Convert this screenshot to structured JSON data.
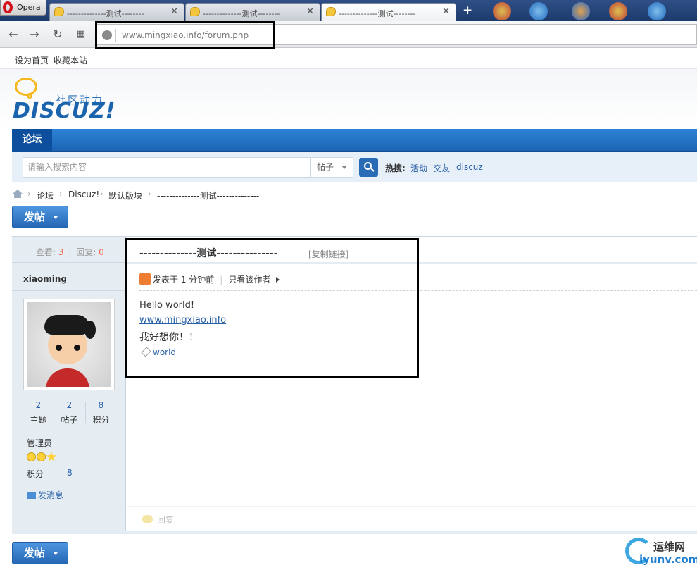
{
  "browser": {
    "app_label": "Opera",
    "tabs": [
      {
        "label": "--------------测试--------"
      },
      {
        "label": "--------------测试--------"
      },
      {
        "label": "--------------测试--------"
      }
    ],
    "url": "www.mingxiao.info/forum.php"
  },
  "linkbar": {
    "set_home": "设为首页",
    "bookmark": "收藏本站"
  },
  "logo": {
    "text": "DISCUZ!",
    "subtitle": "社区动力"
  },
  "nav": {
    "forum": "论坛"
  },
  "search": {
    "placeholder": "请输入搜索内容",
    "scope": "帖子",
    "hot_label": "热搜:",
    "hot_links": [
      "活动",
      "交友",
      "discuz"
    ]
  },
  "breadcrumb": [
    "论坛",
    "Discuz!",
    "默认版块",
    "--------------测试--------------"
  ],
  "post_button": "发帖",
  "thread": {
    "views_label": "查看:",
    "views": "3",
    "replies_label": "回复:",
    "replies": "0",
    "title": "--------------测试---------------",
    "copy_link": "[复制链接]",
    "posted": "发表于 1 分钟前",
    "only_author": "只看该作者",
    "body_line1": "Hello world!",
    "body_link": "www.mingxiao.info",
    "body_line3": "我好想你！！",
    "tag": "world",
    "reply": "回复"
  },
  "author": {
    "name": "xiaoming",
    "stats": [
      {
        "value": "2",
        "label": "主题"
      },
      {
        "value": "2",
        "label": "帖子"
      },
      {
        "value": "8",
        "label": "积分"
      }
    ],
    "role": "管理员",
    "points_label": "积分",
    "points": "8",
    "message": "发消息"
  },
  "watermark": {
    "cn": "运维网",
    "en": "iyunv.com"
  }
}
